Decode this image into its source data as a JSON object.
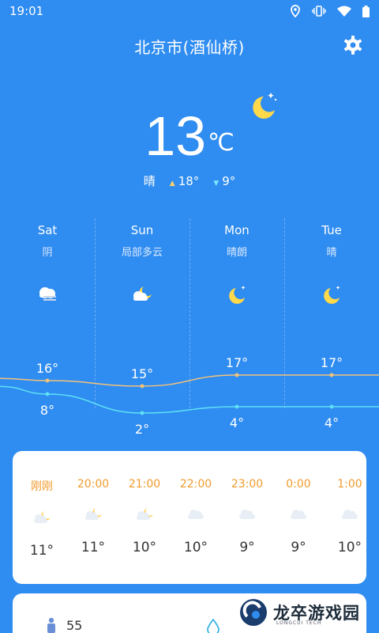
{
  "status_bar": {
    "time": "19:01"
  },
  "header": {
    "city": "北京市(酒仙桥)"
  },
  "current": {
    "temp": "13",
    "unit": "℃",
    "condition": "晴",
    "high": "18°",
    "low": "9°"
  },
  "forecast": [
    {
      "day": "Sat",
      "cond": "阴",
      "icon": "overcast-icon",
      "high": "16°",
      "low": "8°"
    },
    {
      "day": "Sun",
      "cond": "局部多云",
      "icon": "partly-cloudy-night-icon",
      "high": "15°",
      "low": "2°"
    },
    {
      "day": "Mon",
      "cond": "晴朗",
      "icon": "moon-icon",
      "high": "17°",
      "low": "4°"
    },
    {
      "day": "Tue",
      "cond": "晴",
      "icon": "moon-icon",
      "high": "17°",
      "low": "4°"
    }
  ],
  "hourly": [
    {
      "time": "刚刚",
      "icon": "partly-cloudy-night-icon",
      "temp": "11°"
    },
    {
      "time": "20:00",
      "icon": "partly-cloudy-night-icon",
      "temp": "11°"
    },
    {
      "time": "21:00",
      "icon": "partly-cloudy-night-icon",
      "temp": "10°"
    },
    {
      "time": "22:00",
      "icon": "cloud-icon",
      "temp": "10°"
    },
    {
      "time": "23:00",
      "icon": "cloud-icon",
      "temp": "9°"
    },
    {
      "time": "0:00",
      "icon": "cloud-icon",
      "temp": "9°"
    },
    {
      "time": "1:00",
      "icon": "cloud-icon",
      "temp": "10°"
    }
  ],
  "details": {
    "value": "55"
  },
  "watermark": {
    "text": "龙卒游戏园",
    "sub": "LONGCUI TECH"
  },
  "colors": {
    "background": "#2f8cf0",
    "high_curve": "#f3c27a",
    "low_curve": "#5fe0f5",
    "hour_label": "#f29b2c"
  }
}
